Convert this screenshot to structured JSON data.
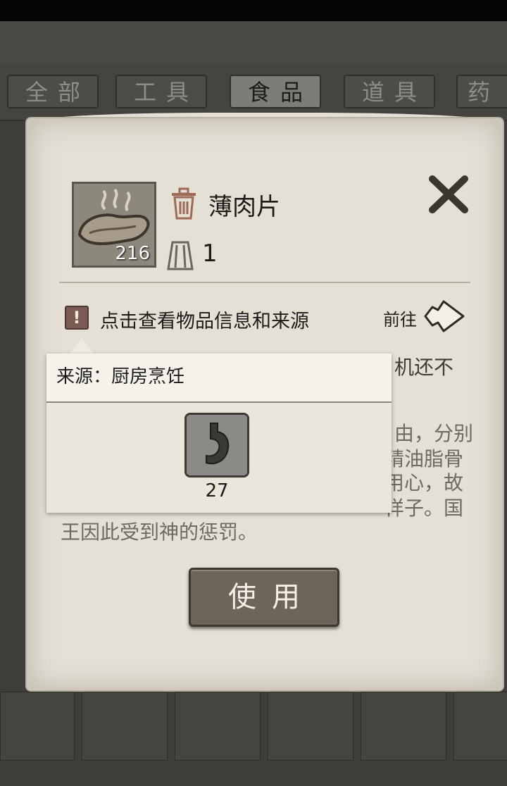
{
  "tabs": [
    {
      "label": "全部",
      "active": false
    },
    {
      "label": "工具",
      "active": false
    },
    {
      "label": "食品",
      "active": true
    },
    {
      "label": "道具",
      "active": false
    },
    {
      "label": "药品",
      "active": false
    }
  ],
  "item": {
    "name": "薄肉片",
    "count": "216",
    "weight": "1",
    "icon": "meat-slice-icon"
  },
  "info_link": "点击查看物品信息和来源",
  "goto_label": "前往",
  "description": {
    "line1": "机还不",
    "line2": "由，分别",
    "line3": "精油脂骨",
    "line4": "用心，故",
    "line5": "样子。国",
    "line6": "王因此受到神的惩罚。"
  },
  "popup": {
    "source": "来源：厨房烹饪",
    "stomach_value": "27",
    "icon": "stomach-icon"
  },
  "use_button": "使用",
  "colors": {
    "parchment": "#e4e0d6",
    "warning": "#7a5a52",
    "button": "#6d655a"
  }
}
